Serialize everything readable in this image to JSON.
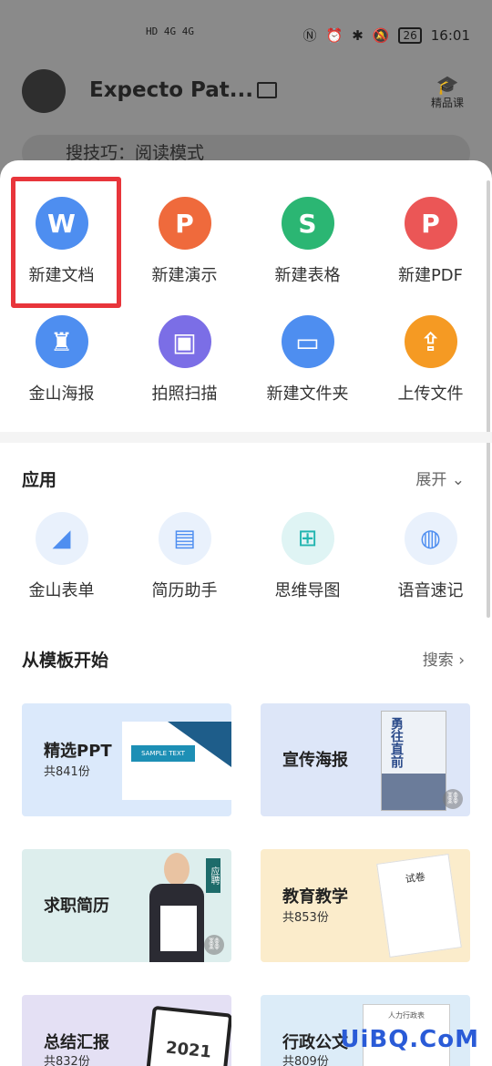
{
  "status_bar": {
    "time": "16:01",
    "battery": "26",
    "left_icons": "HD 4G 4G"
  },
  "background": {
    "username": "Expecto Pat...",
    "course_label": "精品课",
    "search_placeholder": "搜技巧：阅读模式"
  },
  "create": {
    "items": [
      {
        "label": "新建文档",
        "icon": "W",
        "color": "#4e8ef0"
      },
      {
        "label": "新建演示",
        "icon": "P",
        "color": "#ef6a3c"
      },
      {
        "label": "新建表格",
        "icon": "S",
        "color": "#2bb673"
      },
      {
        "label": "新建PDF",
        "icon": "P",
        "color": "#eb5656"
      },
      {
        "label": "金山海报",
        "icon": "♜",
        "color": "#4e8ef0"
      },
      {
        "label": "拍照扫描",
        "icon": "▣",
        "color": "#7b6ee6"
      },
      {
        "label": "新建文件夹",
        "icon": "▭",
        "color": "#4e8ef0"
      },
      {
        "label": "上传文件",
        "icon": "⇪",
        "color": "#f59a23"
      }
    ]
  },
  "apps": {
    "title": "应用",
    "expand_label": "展开",
    "items": [
      {
        "label": "金山表单",
        "icon": "◢"
      },
      {
        "label": "简历助手",
        "icon": "▤"
      },
      {
        "label": "思维导图",
        "icon": "⊞"
      },
      {
        "label": "语音速记",
        "icon": "◍"
      }
    ]
  },
  "templates": {
    "title": "从模板开始",
    "search_label": "搜索",
    "cards": [
      {
        "title": "精选PPT",
        "count": "共841份",
        "color": "#dbe9fb",
        "extra": "SAMPLE TEXT"
      },
      {
        "title": "宣传海报",
        "count": "",
        "color": "#dde6f8",
        "extra": "勇往直前"
      },
      {
        "title": "求职简历",
        "count": "",
        "color": "#ddeeed",
        "extra": "应聘"
      },
      {
        "title": "教育教学",
        "count": "共853份",
        "color": "#fbeccb",
        "extra": "试卷"
      },
      {
        "title": "总结汇报",
        "count": "共832份",
        "color": "#e4e0f4",
        "extra": "2021"
      },
      {
        "title": "行政公文",
        "count": "共809份",
        "color": "#dcecf8",
        "extra": "人力行政表"
      }
    ]
  },
  "watermark": "UiBQ.CoM"
}
